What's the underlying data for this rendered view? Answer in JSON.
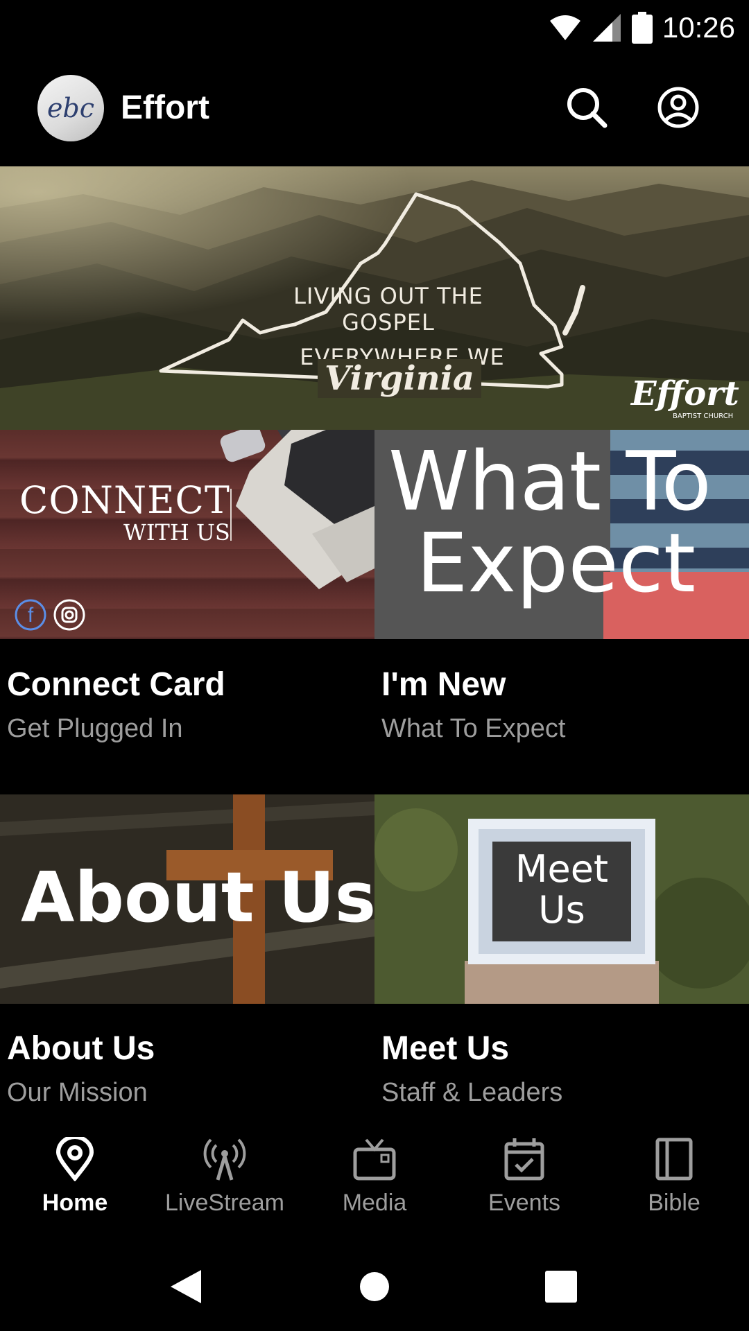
{
  "status_bar": {
    "time": "10:26"
  },
  "app_bar": {
    "logo_text": "ebc",
    "title": "Effort"
  },
  "hero": {
    "line1": "LIVING OUT THE GOSPEL",
    "line2": "EVERYWHERE WE GO.",
    "state": "Virginia",
    "brand": "Effort",
    "brand_sub": "BAPTIST CHURCH"
  },
  "tiles": [
    {
      "image_line1": "CONNECT",
      "image_line2": "WITH US",
      "title": "Connect Card",
      "subtitle": "Get Plugged In"
    },
    {
      "image_line1": "What To",
      "image_line2": "Expect",
      "title": "I'm New",
      "subtitle": "What To Expect"
    },
    {
      "image_text": "About Us",
      "title": "About Us",
      "subtitle": "Our Mission"
    },
    {
      "image_line1": "Meet",
      "image_line2": "Us",
      "title": "Meet Us",
      "subtitle": "Staff & Leaders"
    }
  ],
  "bottom_nav": [
    {
      "label": "Home",
      "icon": "location-pin-icon",
      "active": true
    },
    {
      "label": "LiveStream",
      "icon": "broadcast-icon",
      "active": false
    },
    {
      "label": "Media",
      "icon": "tv-icon",
      "active": false
    },
    {
      "label": "Events",
      "icon": "calendar-check-icon",
      "active": false
    },
    {
      "label": "Bible",
      "icon": "book-icon",
      "active": false
    }
  ],
  "colors": {
    "background": "#000000",
    "subtitle_gray": "#9e9e9e",
    "nav_inactive": "#9e9e9e"
  }
}
